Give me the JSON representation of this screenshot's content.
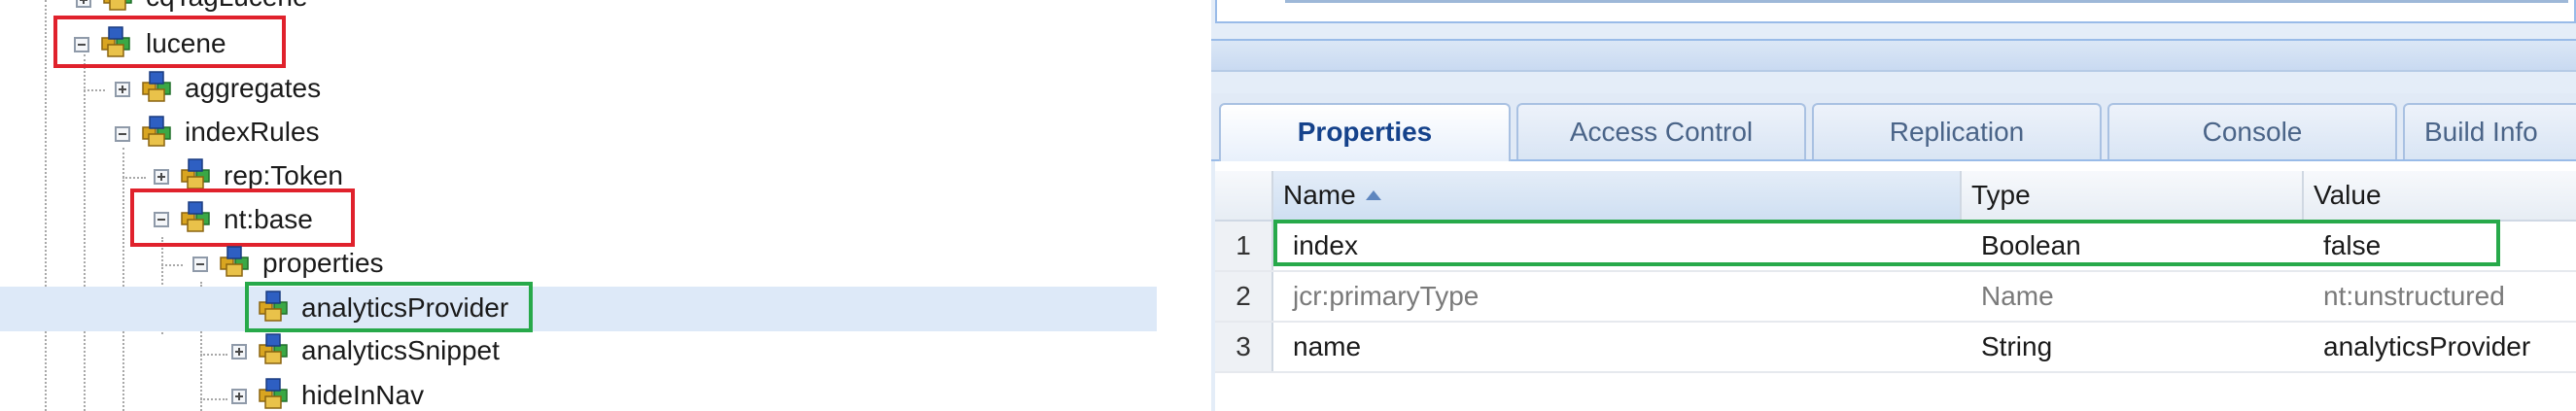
{
  "tree": {
    "nodes": [
      {
        "label": "cqTagLucene",
        "expanded": false
      },
      {
        "label": "lucene",
        "expanded": true
      },
      {
        "label": "aggregates",
        "expanded": false
      },
      {
        "label": "indexRules",
        "expanded": true
      },
      {
        "label": "rep:Token",
        "expanded": false
      },
      {
        "label": "nt:base",
        "expanded": true
      },
      {
        "label": "properties",
        "expanded": true
      },
      {
        "label": "analyticsProvider",
        "selected": true
      },
      {
        "label": "analyticsSnippet",
        "expanded": false
      },
      {
        "label": "hideInNav",
        "expanded": false
      }
    ]
  },
  "tabs": [
    "Properties",
    "Access Control",
    "Replication",
    "Console",
    "Build Info"
  ],
  "active_tab": "Properties",
  "grid": {
    "columns": [
      "Name",
      "Type",
      "Value"
    ],
    "sorted_column": "Name",
    "sort_direction": "ascending",
    "rows": [
      {
        "num": "1",
        "name": "index",
        "type": "Boolean",
        "value": "false"
      },
      {
        "num": "2",
        "name": "jcr:primaryType",
        "type": "Name",
        "value": "nt:unstructured"
      },
      {
        "num": "3",
        "name": "name",
        "type": "String",
        "value": "analyticsProvider"
      }
    ]
  },
  "colors": {
    "highlight_red": "#e0222c",
    "highlight_green": "#27a94a",
    "selection_bg": "#dde9f8",
    "tab_active_text": "#15428b"
  }
}
